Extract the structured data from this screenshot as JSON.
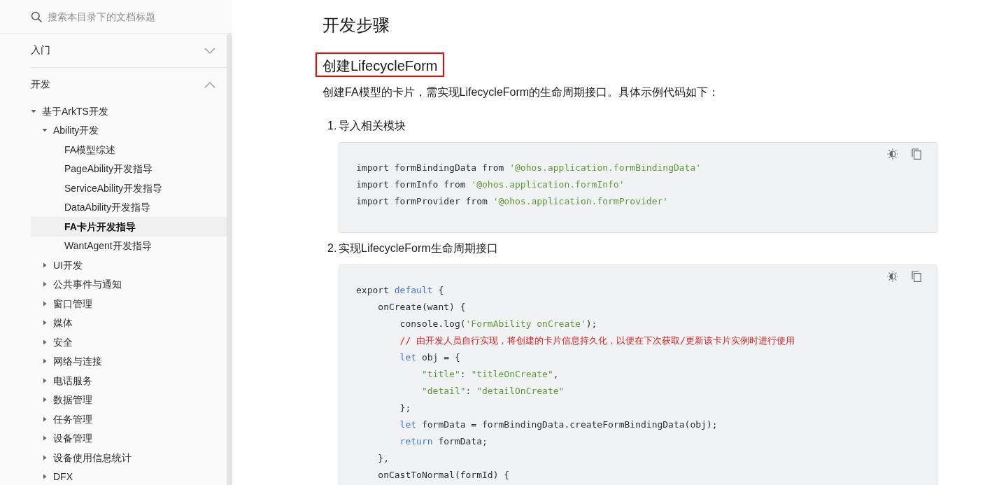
{
  "sidebar": {
    "search": {
      "placeholder": "搜索本目录下的文档标题"
    },
    "sections": [
      {
        "label": "入门",
        "expanded": false
      },
      {
        "label": "开发",
        "expanded": true,
        "children": [
          {
            "label": "基于ArkTS开发",
            "expanded": true,
            "selected": false,
            "children": [
              {
                "label": "Ability开发",
                "expanded": true,
                "selected": false,
                "children": [
                  {
                    "label": "FA模型综述",
                    "selected": false
                  },
                  {
                    "label": "PageAbility开发指导",
                    "selected": false
                  },
                  {
                    "label": "ServiceAbility开发指导",
                    "selected": false
                  },
                  {
                    "label": "DataAbility开发指导",
                    "selected": false
                  },
                  {
                    "label": "FA卡片开发指导",
                    "selected": true
                  },
                  {
                    "label": "WantAgent开发指导",
                    "selected": false
                  }
                ]
              },
              {
                "label": "UI开发",
                "expanded": false,
                "selected": false
              },
              {
                "label": "公共事件与通知",
                "expanded": false,
                "selected": false
              },
              {
                "label": "窗口管理",
                "expanded": false,
                "selected": false
              },
              {
                "label": "媒体",
                "expanded": false,
                "selected": false
              },
              {
                "label": "安全",
                "expanded": false,
                "selected": false
              },
              {
                "label": "网络与连接",
                "expanded": false,
                "selected": false
              },
              {
                "label": "电话服务",
                "expanded": false,
                "selected": false
              },
              {
                "label": "数据管理",
                "expanded": false,
                "selected": false
              },
              {
                "label": "任务管理",
                "expanded": false,
                "selected": false
              },
              {
                "label": "设备管理",
                "expanded": false,
                "selected": false
              },
              {
                "label": "设备使用信息统计",
                "expanded": false,
                "selected": false
              },
              {
                "label": "DFX",
                "expanded": false,
                "selected": false
              }
            ]
          }
        ]
      }
    ]
  },
  "content": {
    "title": "开发步骤",
    "section": {
      "title": "创建LifecycleForm",
      "highlighted": true
    },
    "intro": "创建FA模型的卡片，需实现LifecycleForm的生命周期接口。具体示例代码如下：",
    "steps": [
      {
        "number": "1.",
        "title": "导入相关模块",
        "code": {
          "lines": [
            [
              {
                "kind": "plain",
                "text": "import formBindingData from "
              },
              {
                "kind": "string",
                "text": "'@ohos.application.formBindingData'"
              }
            ],
            [
              {
                "kind": "plain",
                "text": "import formInfo from "
              },
              {
                "kind": "string",
                "text": "'@ohos.application.formInfo'"
              }
            ],
            [
              {
                "kind": "plain",
                "text": "import formProvider from "
              },
              {
                "kind": "string",
                "text": "'@ohos.application.formProvider'"
              }
            ]
          ]
        }
      },
      {
        "number": "2.",
        "title": "实现LifecycleForm生命周期接口",
        "code": {
          "lines": [
            [
              {
                "kind": "plain",
                "text": "export "
              },
              {
                "kind": "keyword",
                "text": "default"
              },
              {
                "kind": "plain",
                "text": " {"
              }
            ],
            [
              {
                "kind": "plain",
                "text": "    onCreate(want) {"
              }
            ],
            [
              {
                "kind": "plain",
                "text": "        console.log("
              },
              {
                "kind": "string",
                "text": "'FormAbility onCreate'"
              },
              {
                "kind": "plain",
                "text": ");"
              }
            ],
            [
              {
                "kind": "comment",
                "text": "        // 由开发人员自行实现，将创建的卡片信息持久化，以便在下次获取/更新该卡片实例时进行使用"
              }
            ],
            [
              {
                "kind": "keyword",
                "text": "        let"
              },
              {
                "kind": "plain",
                "text": " obj = {"
              }
            ],
            [
              {
                "kind": "string",
                "text": "            \"title\""
              },
              {
                "kind": "plain",
                "text": ": "
              },
              {
                "kind": "string",
                "text": "\"titleOnCreate\""
              },
              {
                "kind": "plain",
                "text": ","
              }
            ],
            [
              {
                "kind": "string",
                "text": "            \"detail\""
              },
              {
                "kind": "plain",
                "text": ": "
              },
              {
                "kind": "string",
                "text": "\"detailOnCreate\""
              }
            ],
            [
              {
                "kind": "plain",
                "text": "        };"
              }
            ],
            [
              {
                "kind": "keyword",
                "text": "        let"
              },
              {
                "kind": "plain",
                "text": " formData = formBindingData.createFormBindingData(obj);"
              }
            ],
            [
              {
                "kind": "keyword",
                "text": "        return"
              },
              {
                "kind": "plain",
                "text": " formData;"
              }
            ],
            [
              {
                "kind": "plain",
                "text": "    },"
              }
            ],
            [
              {
                "kind": "plain",
                "text": "    onCastToNormal(formId) {"
              }
            ]
          ]
        }
      }
    ]
  }
}
